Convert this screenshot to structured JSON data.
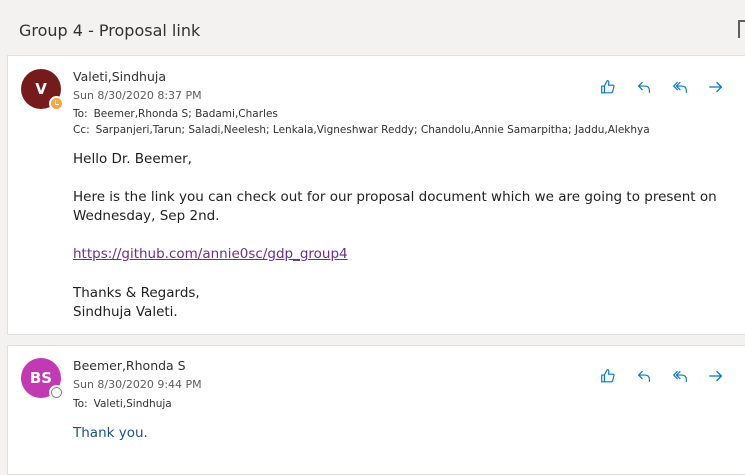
{
  "thread": {
    "subject": "Group 4 - Proposal link"
  },
  "messages": [
    {
      "initials": "V",
      "sender": "Valeti,Sindhuja",
      "date": "Sun 8/30/2020 8:37 PM",
      "to_label": "To:",
      "to": "Beemer,Rhonda S; Badami,Charles",
      "cc_label": "Cc:",
      "cc": "Sarpanjeri,Tarun; Saladi,Neelesh; Lenkala,Vigneshwar Reddy; Chandolu,Annie Samarpitha; Jaddu,Alekhya",
      "greeting": "Hello Dr. Beemer,",
      "para1": "Here is the link you can check out for our proposal document which we are going to present on",
      "para1b": "Wednesday, Sep 2nd.",
      "link": "https://github.com/annie0sc/gdp_group4",
      "closing": "Thanks & Regards,",
      "signature": "Sindhuja Valeti.",
      "avatar_color": "#751b1b",
      "presence": "away"
    },
    {
      "initials": "BS",
      "sender": "Beemer,Rhonda S",
      "date": "Sun 8/30/2020 9:44 PM",
      "to_label": "To:",
      "to": "Valeti,Sindhuja",
      "body": "Thank you.",
      "avatar_color": "#c239b3",
      "presence": "offline"
    }
  ],
  "actions": [
    "like-icon",
    "reply-icon",
    "reply-all-icon",
    "forward-icon"
  ],
  "colors": {
    "accent": "#0078d4",
    "link": "#6b2f8a"
  }
}
